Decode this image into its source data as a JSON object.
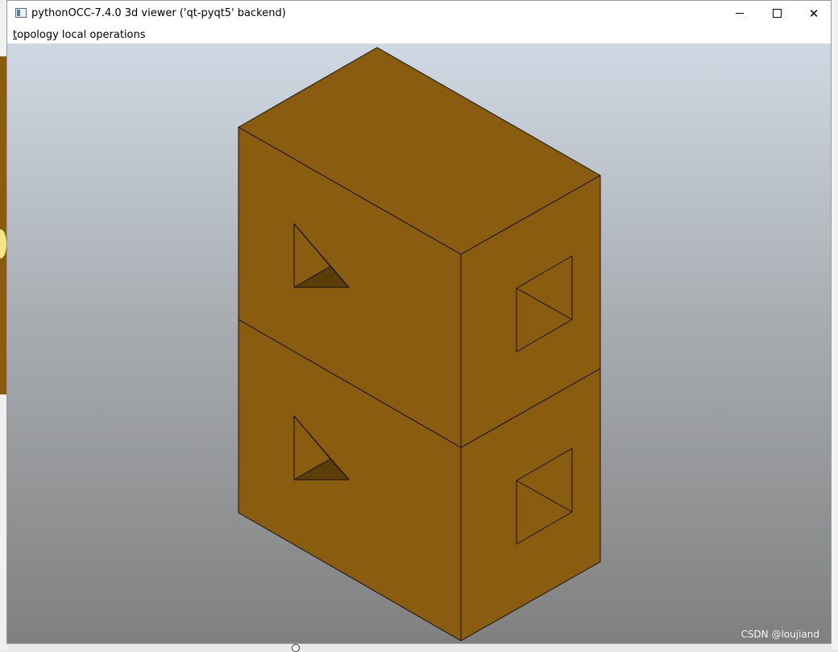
{
  "window": {
    "title": "pythonOCC-7.4.0 3d viewer ('qt-pyqt5' backend)",
    "controls": {
      "minimize": "minimize",
      "maximize": "maximize",
      "close": "✕"
    }
  },
  "menubar": {
    "items": [
      {
        "accel": "t",
        "rest": "opology local operations"
      }
    ]
  },
  "viewport": {
    "background_top": "#cfd9e3",
    "background_bottom": "#808080",
    "shape_color": "#8a5c0f",
    "shape_shadow_color": "#5e3e08",
    "edge_color": "#111111"
  },
  "watermark": {
    "text": "CSDN @loujiand"
  }
}
